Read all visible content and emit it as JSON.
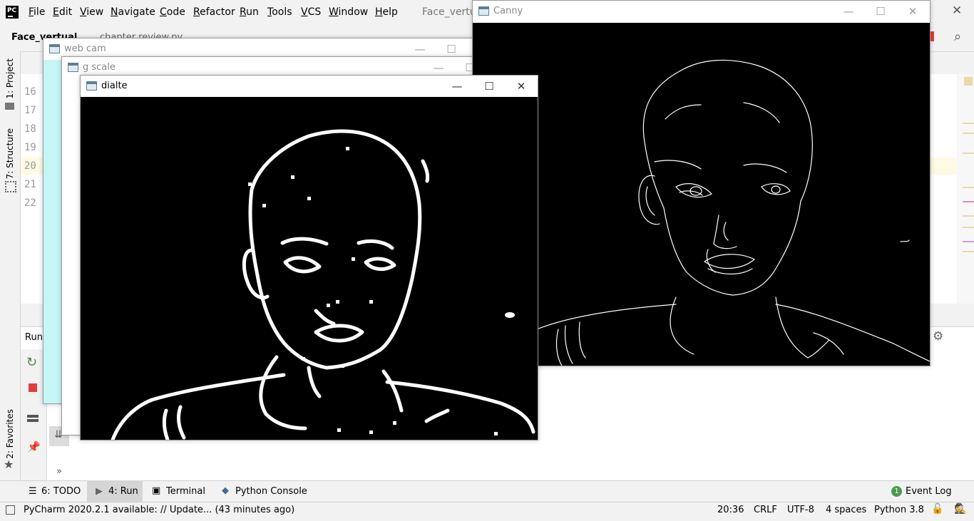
{
  "menu": {
    "items": [
      "File",
      "Edit",
      "View",
      "Navigate",
      "Code",
      "Refactor",
      "Run",
      "Tools",
      "VCS",
      "Window",
      "Help"
    ],
    "ide_title": "Face_vertua"
  },
  "nav": {
    "project": "Face_vertual",
    "file": "chapter review.py"
  },
  "side_tabs": {
    "project": "1: Project",
    "structure": "7: Structure",
    "favorites": "2: Favorites"
  },
  "editor": {
    "line_numbers": [
      "16",
      "17",
      "18",
      "19",
      "20",
      "21",
      "22"
    ],
    "current_line": "20"
  },
  "run_panel": {
    "label": "Run:"
  },
  "windows": {
    "webcam": "web cam",
    "gray": "g scale",
    "dilate": "dialte",
    "canny": "Canny"
  },
  "bottom_tabs": {
    "todo": "6: TODO",
    "run": "4: Run",
    "terminal": "Terminal",
    "console": "Python Console",
    "event_log": "Event Log",
    "event_count": "1"
  },
  "status": {
    "message": "PyCharm 2020.2.1 available: // Update... (43 minutes ago)",
    "position": "20:36",
    "line_sep": "CRLF",
    "encoding": "UTF-8",
    "indent": "4 spaces",
    "interpreter": "Python 3.8"
  },
  "colors": {
    "accent": "#4a8c3f",
    "stop": "#e0403b",
    "webcam_bg": "#c4f6f6"
  }
}
